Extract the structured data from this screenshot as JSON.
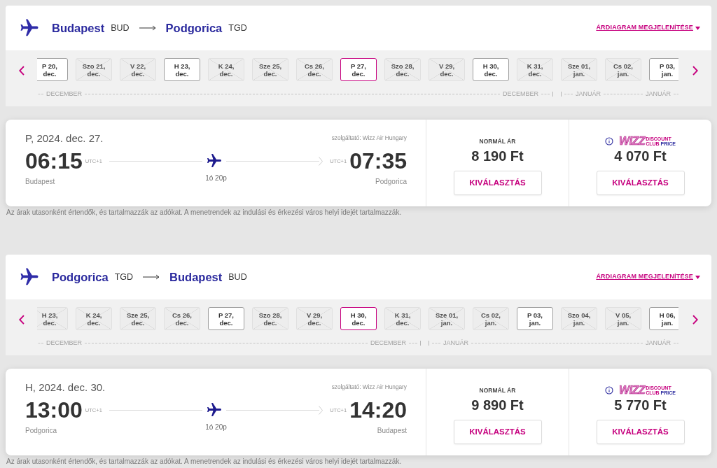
{
  "sections": [
    {
      "route": {
        "origin": {
          "city": "Budapest",
          "code": "BUD"
        },
        "destination": {
          "city": "Podgorica",
          "code": "TGD"
        }
      },
      "price_chart_link": "ÁRDIAGRAM MEGJELENÍTÉSE",
      "date_strip": {
        "months": [
          {
            "start_label": "DECEMBER",
            "end_label": "DECEMBER",
            "dates": [
              {
                "day": "P 20,",
                "month": "dec.",
                "available": true,
                "selected": false
              },
              {
                "day": "Szo 21,",
                "month": "dec.",
                "available": false,
                "selected": false
              },
              {
                "day": "V 22,",
                "month": "dec.",
                "available": false,
                "selected": false
              },
              {
                "day": "H 23,",
                "month": "dec.",
                "available": true,
                "selected": false
              },
              {
                "day": "K 24,",
                "month": "dec.",
                "available": false,
                "selected": false
              },
              {
                "day": "Sze 25,",
                "month": "dec.",
                "available": false,
                "selected": false
              },
              {
                "day": "Cs 26,",
                "month": "dec.",
                "available": false,
                "selected": false
              },
              {
                "day": "P 27,",
                "month": "dec.",
                "available": true,
                "selected": true
              },
              {
                "day": "Szo 28,",
                "month": "dec.",
                "available": false,
                "selected": false
              },
              {
                "day": "V 29,",
                "month": "dec.",
                "available": false,
                "selected": false
              },
              {
                "day": "H 30,",
                "month": "dec.",
                "available": true,
                "selected": false
              },
              {
                "day": "K 31,",
                "month": "dec.",
                "available": false,
                "selected": false
              }
            ]
          },
          {
            "start_label": "JANUÁR",
            "end_label": "JANUÁR",
            "dates": [
              {
                "day": "Sze 01,",
                "month": "jan.",
                "available": false,
                "selected": false
              },
              {
                "day": "Cs 02,",
                "month": "jan.",
                "available": false,
                "selected": false
              },
              {
                "day": "P 03,",
                "month": "jan.",
                "available": true,
                "selected": false
              }
            ]
          }
        ]
      },
      "flight": {
        "date": "P, 2024. dec. 27.",
        "operator": "szolgáltató: Wizz Air Hungary",
        "departure": {
          "time": "06:15",
          "timezone": "UTC+1",
          "city": "Budapest"
        },
        "arrival": {
          "time": "07:35",
          "timezone": "UTC+1",
          "city": "Podgorica"
        },
        "duration": "1ó 20p",
        "fares": [
          {
            "kind": "normal",
            "label": "NORMÁL ÁR",
            "price": "8 190 Ft",
            "button": "KIVÁLASZTÁS"
          },
          {
            "kind": "club",
            "logo": {
              "wordmark": "WIZZ",
              "tagline_top": "DISCOUNT",
              "tagline_bottom": [
                "CLUB",
                "PRICE"
              ]
            },
            "price": "4 070 Ft",
            "button": "KIVÁLASZTÁS"
          }
        ]
      },
      "footnote": "Az árak utasonként értendők, és tartalmazzák az adókat. A menetrendek az indulási és érkezési város helyi idejét tartalmazzák."
    },
    {
      "route": {
        "origin": {
          "city": "Podgorica",
          "code": "TGD"
        },
        "destination": {
          "city": "Budapest",
          "code": "BUD"
        }
      },
      "price_chart_link": "ÁRDIAGRAM MEGJELENÍTÉSE",
      "date_strip": {
        "months": [
          {
            "start_label": "DECEMBER",
            "end_label": "DECEMBER",
            "dates": [
              {
                "day": "H 23,",
                "month": "dec.",
                "available": false,
                "selected": false
              },
              {
                "day": "K 24,",
                "month": "dec.",
                "available": false,
                "selected": false
              },
              {
                "day": "Sze 25,",
                "month": "dec.",
                "available": false,
                "selected": false
              },
              {
                "day": "Cs 26,",
                "month": "dec.",
                "available": false,
                "selected": false
              },
              {
                "day": "P 27,",
                "month": "dec.",
                "available": true,
                "selected": false
              },
              {
                "day": "Szo 28,",
                "month": "dec.",
                "available": false,
                "selected": false
              },
              {
                "day": "V 29,",
                "month": "dec.",
                "available": false,
                "selected": false
              },
              {
                "day": "H 30,",
                "month": "dec.",
                "available": true,
                "selected": true
              },
              {
                "day": "K 31,",
                "month": "dec.",
                "available": false,
                "selected": false
              }
            ]
          },
          {
            "start_label": "JANUÁR",
            "end_label": "JANUÁR",
            "dates": [
              {
                "day": "Sze 01,",
                "month": "jan.",
                "available": false,
                "selected": false
              },
              {
                "day": "Cs 02,",
                "month": "jan.",
                "available": false,
                "selected": false
              },
              {
                "day": "P 03,",
                "month": "jan.",
                "available": true,
                "selected": false
              },
              {
                "day": "Szo 04,",
                "month": "jan.",
                "available": false,
                "selected": false
              },
              {
                "day": "V 05,",
                "month": "jan.",
                "available": false,
                "selected": false
              },
              {
                "day": "H 06,",
                "month": "jan.",
                "available": true,
                "selected": false
              }
            ]
          }
        ]
      },
      "flight": {
        "date": "H, 2024. dec. 30.",
        "operator": "szolgáltató: Wizz Air Hungary",
        "departure": {
          "time": "13:00",
          "timezone": "UTC+1",
          "city": "Podgorica"
        },
        "arrival": {
          "time": "14:20",
          "timezone": "UTC+1",
          "city": "Budapest"
        },
        "duration": "1ó 20p",
        "fares": [
          {
            "kind": "normal",
            "label": "NORMÁL ÁR",
            "price": "9 890 Ft",
            "button": "KIVÁLASZTÁS"
          },
          {
            "kind": "club",
            "logo": {
              "wordmark": "WIZZ",
              "tagline_top": "DISCOUNT",
              "tagline_bottom": [
                "CLUB",
                "PRICE"
              ]
            },
            "price": "5 770 Ft",
            "button": "KIVÁLASZTÁS"
          }
        ]
      },
      "footnote": "Az árak utasonként értendők, és tartalmazzák az adókat. A menetrendek az indulási és érkezési város helyi idejét tartalmazzák."
    }
  ]
}
